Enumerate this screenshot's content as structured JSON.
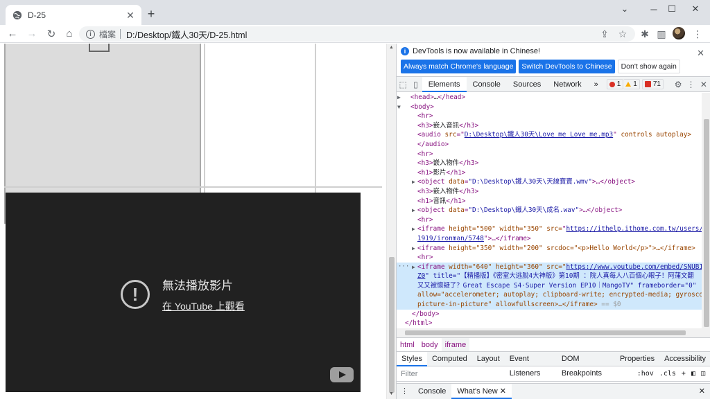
{
  "browser": {
    "tab_title": "D-25",
    "tab_close": "✕",
    "new_tab": "+",
    "scheme_label": "檔案",
    "url": "D:/Desktop/鐵人30天/D-25.html"
  },
  "page": {
    "yt_error_message": "無法播放影片",
    "yt_watch_link": "在 YouTube 上觀看"
  },
  "devtools": {
    "infobar_text": "DevTools is now available in Chinese!",
    "btn_always": "Always match Chrome's language",
    "btn_switch": "Switch DevTools to Chinese",
    "btn_dont": "Don't show again",
    "tabs": [
      "Elements",
      "Console",
      "Sources",
      "Network"
    ],
    "more_tabs": "»",
    "err_count": "1",
    "warn_count": "1",
    "issue_count": "71",
    "dom": {
      "head_open": "<head>",
      "head_ellipsis": "…",
      "head_close": "</head>",
      "body_open": "<body>",
      "hr": "<hr>",
      "h3_open": "<h3>",
      "h3_close": "</h3>",
      "h1_open": "<h1>",
      "h1_close": "</h1>",
      "audio_text": "嵌入音訊",
      "obj_text": "嵌入物件",
      "video_text": "影片",
      "sound_text": "音訊",
      "audio_src": "D:\\Desktop\\鐵人30天\\Love me Love me.mp3",
      "audio_rest": "controls autoplay>",
      "audio_close": "</audio>",
      "obj1": "\"D:\\Desktop\\鐵人30天\\天線寶寶.wmv\"",
      "obj2": "\"D:\\Desktop\\鐵人30天\\成名.wav\"",
      "obj_close": ">…</object>",
      "if1_a": "height=\"500\" width=\"350\" src=",
      "if1_src": "https://ithelp.ithome.com.tw/users/2015",
      "if1_src2": "1919/ironman/5748",
      "if1_close": "\">…</iframe>",
      "if2": "height=\"350\" width=\"200\" srcdoc=\"<p>Hello World</p>\">…</iframe>",
      "if3_a": "width=\"640\" height=\"360\" src=\"",
      "if3_src": "https://www.youtube.com/embed/SNUB1Ham6",
      "if3_src2": "Z0",
      "if3_title": "\" title=\"【精播版】《密室大逃脫4大神版》第10期 ：院人真每人八百個心眼子！阿蒲文翻",
      "if3_title2": "又又被懷疑了？Great Escape S4·Super Version EP10｜MangoTV\" frameborder=\"0\"",
      "if3_allow": "allow=\"accelerometer; autoplay; clipboard-write; encrypted-media; gyroscope;",
      "if3_allow2": "picture-in-picture\" allowfullscreen>…</iframe>",
      "if3_eq": "== $0",
      "body_close": "</body>",
      "html_close": "</html>",
      "dots": "···"
    },
    "crumbs": [
      "html",
      "body",
      "iframe"
    ],
    "subtabs": [
      "Styles",
      "Computed",
      "Layout",
      "Event Listeners",
      "DOM Breakpoints",
      "Properties",
      "Accessibility"
    ],
    "filter_placeholder": "Filter",
    "hov": ":hov",
    "cls": ".cls",
    "drawer_tabs": [
      "Console",
      "What's New"
    ],
    "drawer_close": "✕"
  }
}
